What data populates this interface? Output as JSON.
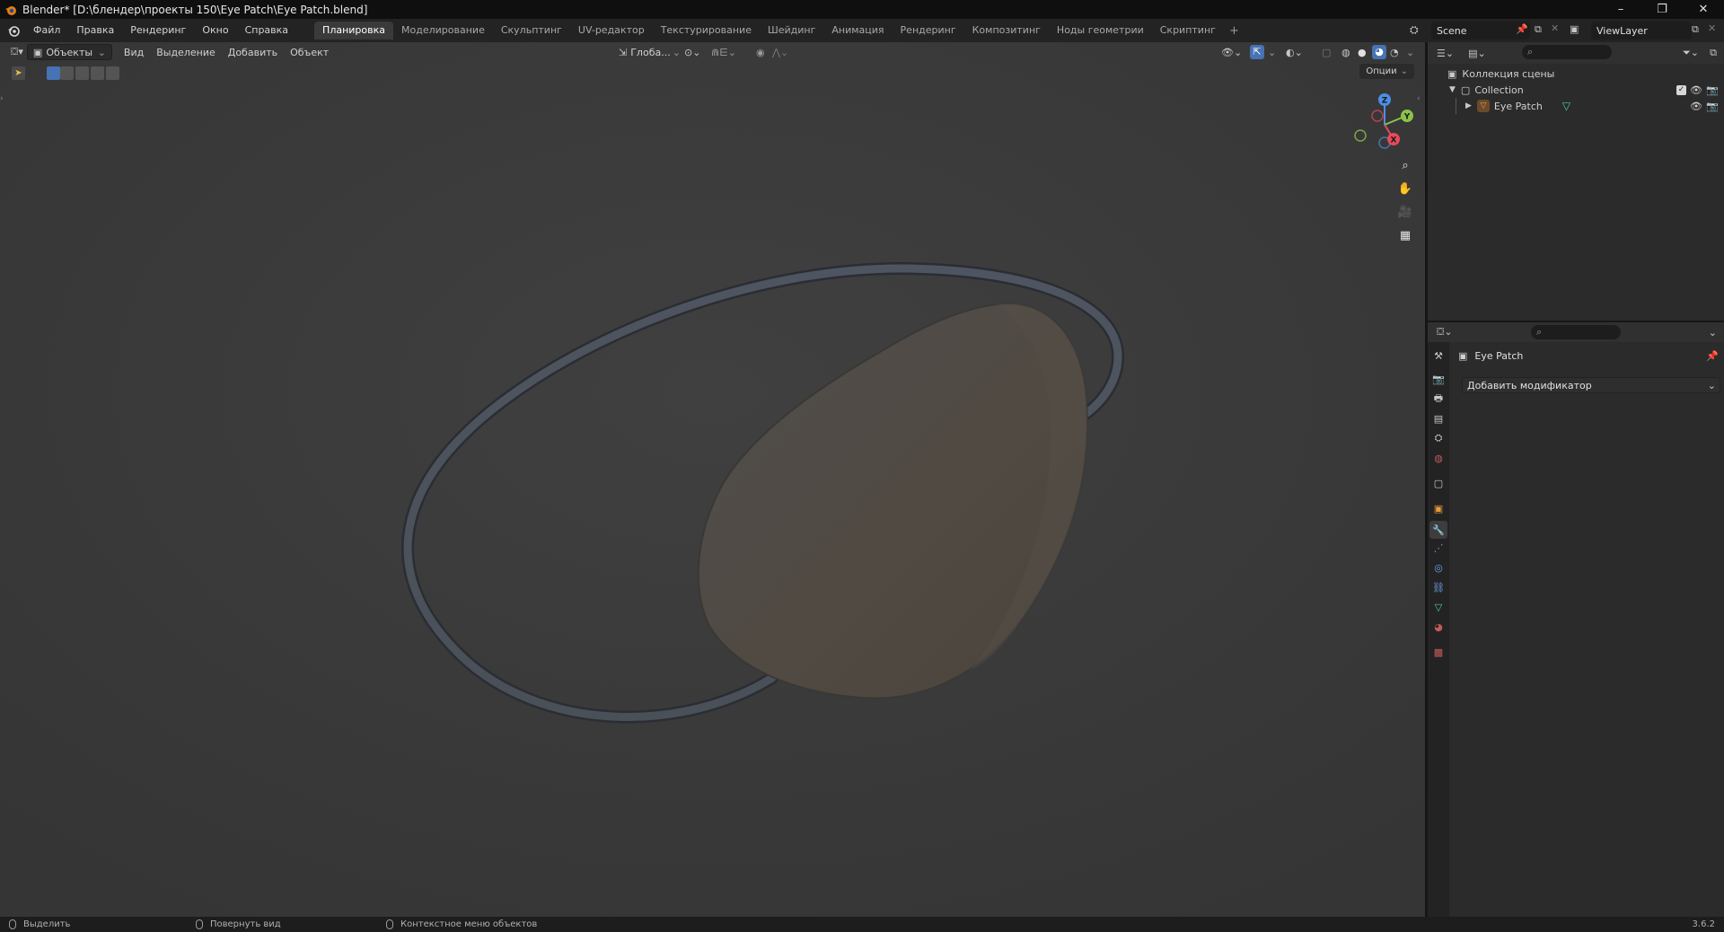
{
  "window": {
    "title": "Blender* [D:\\блендер\\проекты 150\\Eye Patch\\Eye Patch.blend]",
    "minimize": "–",
    "restore": "❐",
    "close": "✕"
  },
  "menubar": {
    "items": [
      "Файл",
      "Правка",
      "Рендеринг",
      "Окно",
      "Справка"
    ],
    "workspaces": [
      "Планировка",
      "Моделирование",
      "Скульптинг",
      "UV-редактор",
      "Текстурирование",
      "Шейдинг",
      "Анимация",
      "Рендеринг",
      "Композитинг",
      "Ноды геометрии",
      "Скриптинг"
    ],
    "active_workspace": "Планировка",
    "add_workspace": "+",
    "scene": "Scene",
    "view_layer": "ViewLayer"
  },
  "viewport": {
    "mode": "Объекты",
    "menus": [
      "Вид",
      "Выделение",
      "Добавить",
      "Объект"
    ],
    "orientation": "Глоба...",
    "options": "Опции",
    "gizmo": {
      "x": "X",
      "y": "Y",
      "z": "Z"
    }
  },
  "outliner": {
    "scene_collection": "Коллекция сцены",
    "collection": "Collection",
    "object": "Eye Patch"
  },
  "properties": {
    "object_name": "Eye Patch",
    "add_modifier": "Добавить модификатор"
  },
  "statusbar": {
    "select": "Выделить",
    "rotate": "Повернуть вид",
    "context": "Контекстное меню объектов",
    "version": "3.6.2"
  },
  "colors": {
    "accent": "#4772b3",
    "viewport_bg": "#3b3b3b",
    "axis_x": "#e54b5b",
    "axis_y": "#8bc34a",
    "axis_z": "#4b8fe5"
  }
}
